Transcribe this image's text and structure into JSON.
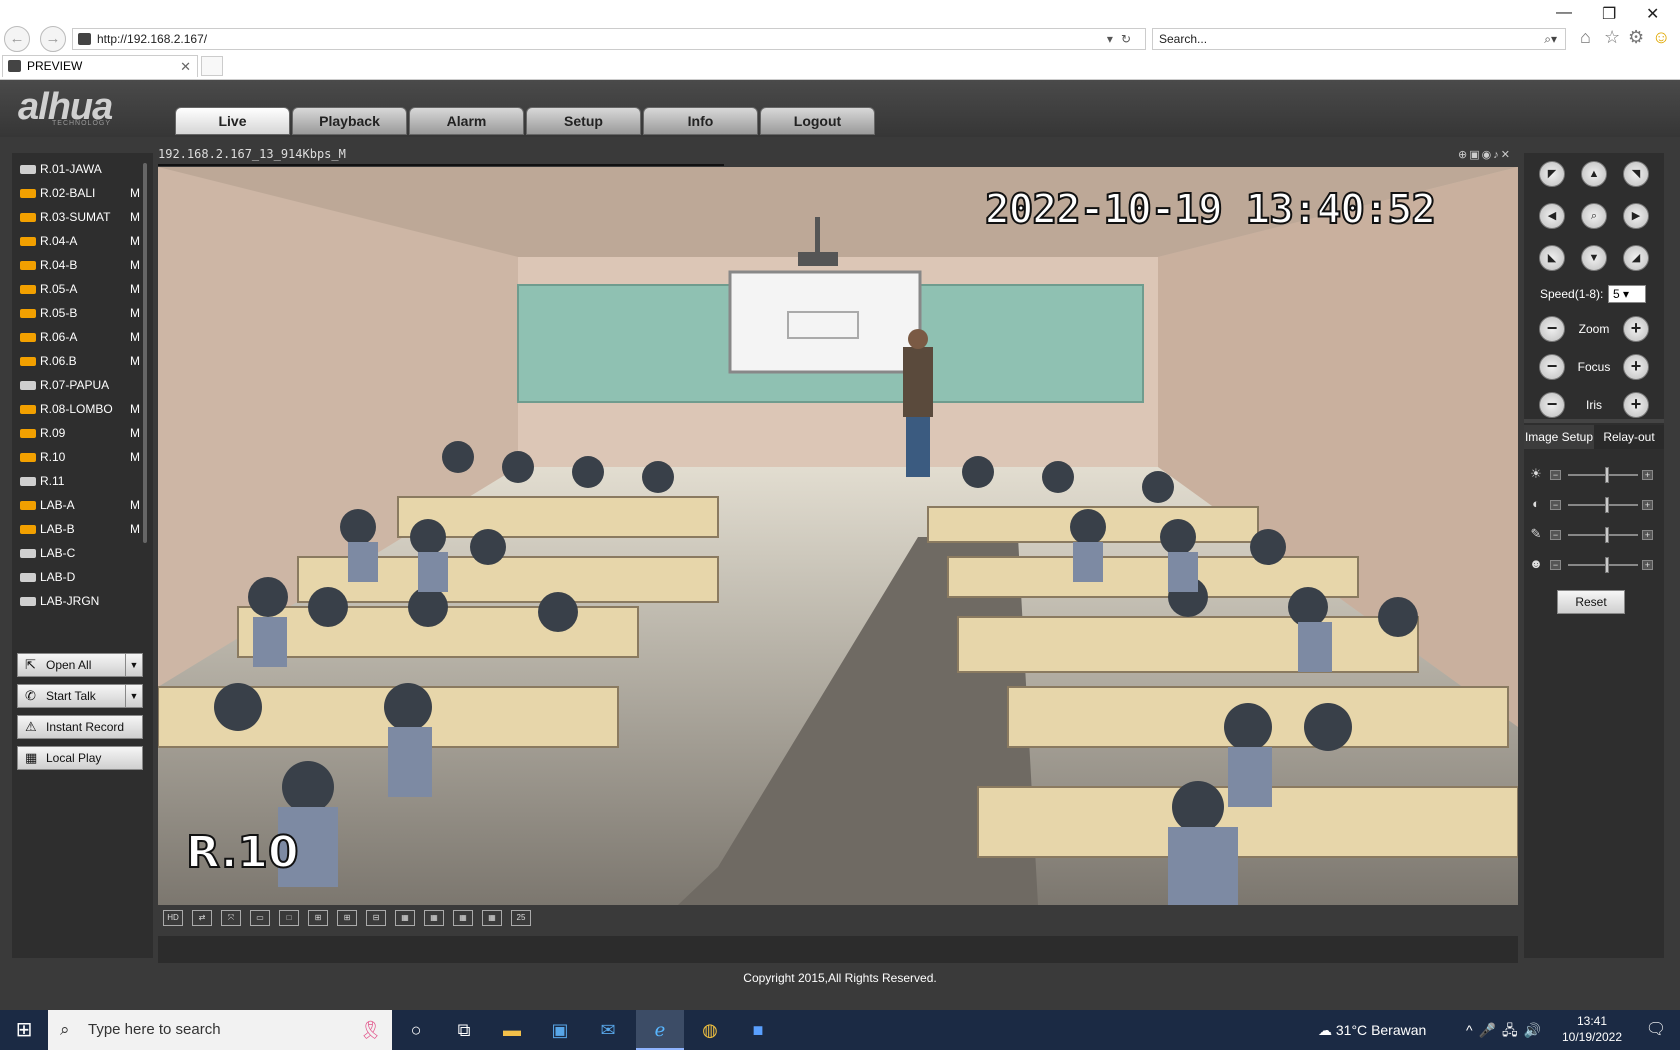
{
  "browser": {
    "address": "http://192.168.2.167/",
    "search_placeholder": "Search...",
    "tab_title": "PREVIEW",
    "minimize": "—",
    "restore": "❐",
    "close": "✕"
  },
  "brand": {
    "logo": "alhua",
    "logo_sub": "TECHNOLOGY"
  },
  "topnav": [
    {
      "label": "Live",
      "active": true
    },
    {
      "label": "Playback"
    },
    {
      "label": "Alarm"
    },
    {
      "label": "Setup"
    },
    {
      "label": "Info"
    },
    {
      "label": "Logout"
    }
  ],
  "devices": [
    {
      "name": "R.01-JAWA",
      "m": "",
      "active": false
    },
    {
      "name": "R.02-BALI",
      "m": "M",
      "active": true
    },
    {
      "name": "R.03-SUMAT",
      "m": "M",
      "active": true
    },
    {
      "name": "R.04-A",
      "m": "M",
      "active": true
    },
    {
      "name": "R.04-B",
      "m": "M",
      "active": true
    },
    {
      "name": "R.05-A",
      "m": "M",
      "active": true
    },
    {
      "name": "R.05-B",
      "m": "M",
      "active": true
    },
    {
      "name": "R.06-A",
      "m": "M",
      "active": true
    },
    {
      "name": "R.06.B",
      "m": "M",
      "active": true
    },
    {
      "name": "R.07-PAPUA",
      "m": "",
      "active": false
    },
    {
      "name": "R.08-LOMBO",
      "m": "M",
      "active": true
    },
    {
      "name": "R.09",
      "m": "M",
      "active": true
    },
    {
      "name": "R.10",
      "m": "M",
      "active": true
    },
    {
      "name": "R.11",
      "m": "",
      "active": false
    },
    {
      "name": "LAB-A",
      "m": "M",
      "active": true
    },
    {
      "name": "LAB-B",
      "m": "M",
      "active": true
    },
    {
      "name": "LAB-C",
      "m": "",
      "active": false
    },
    {
      "name": "LAB-D",
      "m": "",
      "active": false
    },
    {
      "name": "LAB-JRGN",
      "m": "",
      "active": false
    }
  ],
  "actions": {
    "open_all": "Open All",
    "start_talk": "Start Talk",
    "instant_record": "Instant Record",
    "local_play": "Local Play"
  },
  "video": {
    "stream_title": "192.168.2.167_13_914Kbps_M",
    "timestamp": "2022-10-19 13:40:52",
    "channel_label": "R.10",
    "layout_last": "25"
  },
  "ptz": {
    "speed_label": "Speed(1-8):",
    "speed_value": "5",
    "zoom": "Zoom",
    "focus": "Focus",
    "iris": "Iris"
  },
  "image_setup": {
    "tab_image": "Image Setup",
    "tab_relay": "Relay-out",
    "levels": [
      0.55,
      0.55,
      0.55,
      0.55
    ],
    "reset": "Reset"
  },
  "footer": {
    "copyright": "Copyright 2015,All Rights Reserved."
  },
  "taskbar": {
    "search_placeholder": "Type here to search",
    "weather_temp": "31°C",
    "weather_desc": "Berawan",
    "time": "13:41",
    "date": "10/19/2022"
  },
  "colors": {
    "cam_active": "#f2a000",
    "cam_inactive": "#cfcfcf",
    "app_bg": "#3a3a3a"
  }
}
